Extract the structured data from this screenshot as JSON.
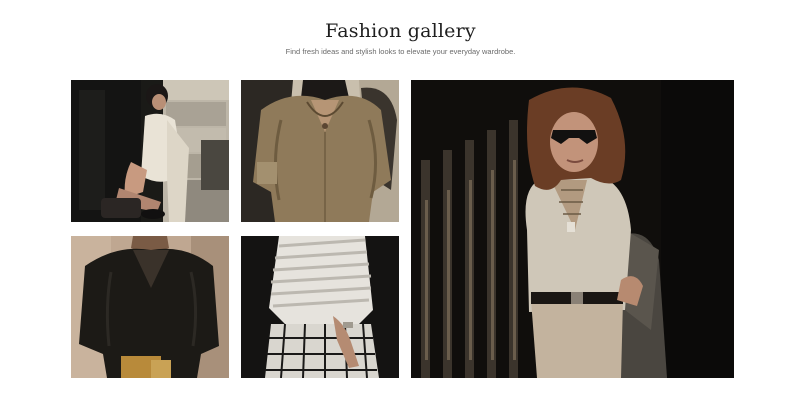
{
  "gallery": {
    "title": "Fashion gallery",
    "subtitle": "Find fresh ideas and stylish looks to elevate your everyday wardrobe."
  },
  "images": [
    {
      "id": "photo-crouching-woman-white-lace-dress"
    },
    {
      "id": "photo-linen-shirt-shadow"
    },
    {
      "id": "photo-black-blouse"
    },
    {
      "id": "photo-striped-shirt-checked-trousers"
    },
    {
      "id": "photo-woman-sunglasses-lace-up-top"
    }
  ],
  "colors": {
    "background": "#ffffff",
    "title": "#1f1f1f",
    "subtitle": "#6b6b6b"
  }
}
